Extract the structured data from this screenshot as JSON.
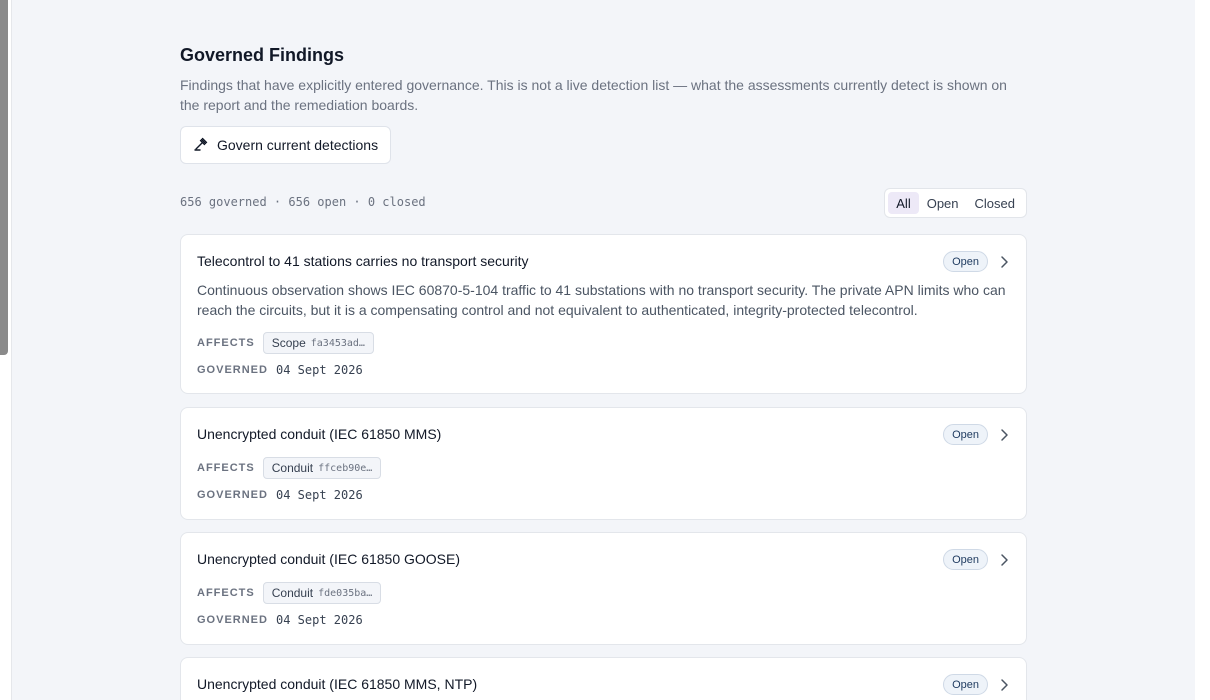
{
  "page": {
    "title": "Governed Findings",
    "subtitle": "Findings that have explicitly entered governance. This is not a live detection list — what the assessments currently detect is shown on the report and the remediation boards.",
    "govern_button_label": "Govern current detections",
    "counts_text": "656 governed · 656 open · 0 closed"
  },
  "filters": [
    {
      "label": "All",
      "active": true
    },
    {
      "label": "Open",
      "active": false
    },
    {
      "label": "Closed",
      "active": false
    }
  ],
  "labels": {
    "affects": "AFFECTS",
    "governed": "GOVERNED"
  },
  "findings": [
    {
      "title": "Telecontrol to 41 stations carries no transport security",
      "status": "Open",
      "description": "Continuous observation shows IEC 60870-5-104 traffic to 41 substations with no transport security. The private APN limits who can reach the circuits, but it is a compensating control and not equivalent to authenticated, integrity-protected telecontrol.",
      "affects_type": "Scope",
      "affects_id": "fa3453ad…",
      "governed_date": "04 Sept 2026"
    },
    {
      "title": "Unencrypted conduit (IEC 61850 MMS)",
      "status": "Open",
      "description": "",
      "affects_type": "Conduit",
      "affects_id": "ffceb90e…",
      "governed_date": "04 Sept 2026"
    },
    {
      "title": "Unencrypted conduit (IEC 61850 GOOSE)",
      "status": "Open",
      "description": "",
      "affects_type": "Conduit",
      "affects_id": "fde035ba…",
      "governed_date": "04 Sept 2026"
    },
    {
      "title": "Unencrypted conduit (IEC 61850 MMS, NTP)",
      "status": "Open",
      "description": "",
      "affects_type": "",
      "affects_id": "",
      "governed_date": ""
    }
  ],
  "icons": {
    "govern": "gavel-icon",
    "chevron": "chevron-right-icon"
  },
  "colors": {
    "accent_active_tab": "#ede9f7",
    "badge_bg": "#eef3f9",
    "page_bg": "#f3f5f9"
  }
}
